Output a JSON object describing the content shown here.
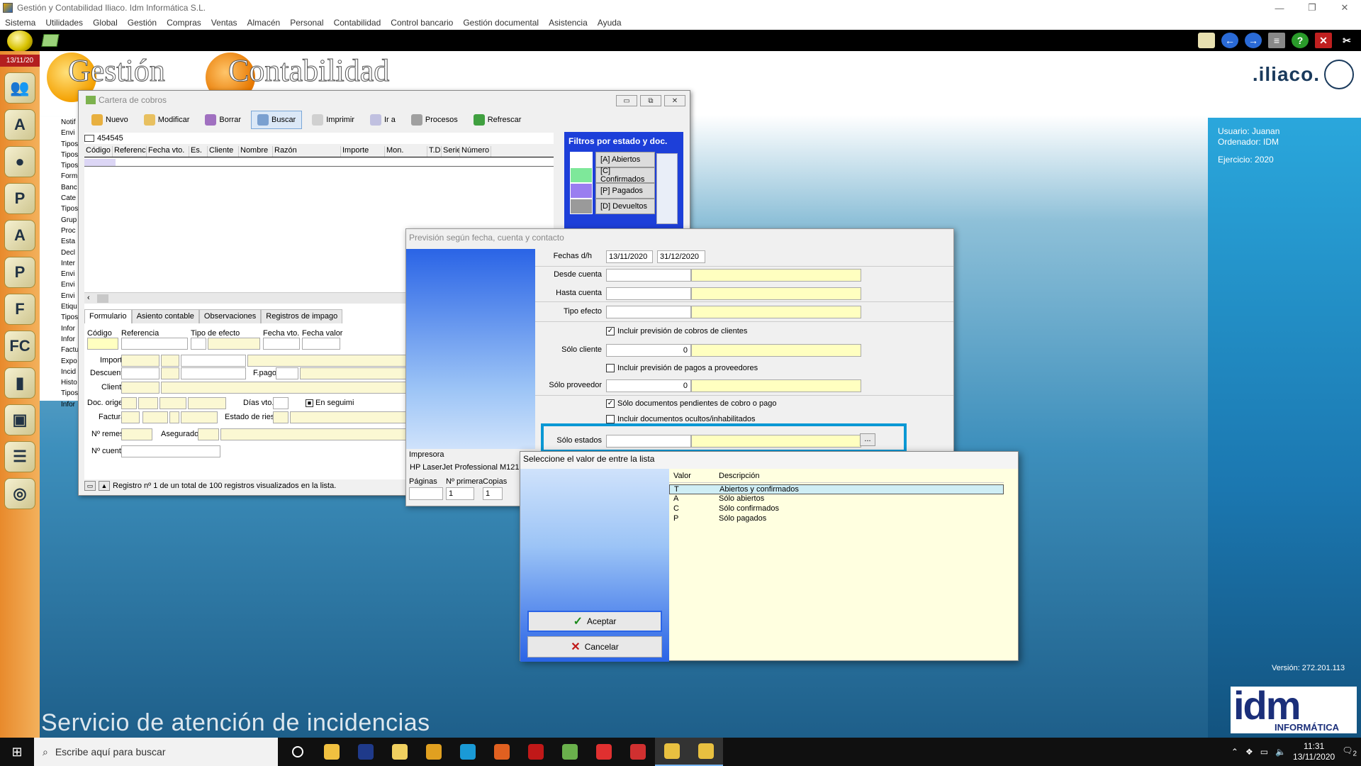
{
  "window": {
    "title": "Gestión y Contabilidad Iliaco. Idm Informática S.L.",
    "controls": [
      "—",
      "❐",
      "✕"
    ]
  },
  "menubar": [
    "Sistema",
    "Utilidades",
    "Global",
    "Gestión",
    "Compras",
    "Ventas",
    "Almacén",
    "Personal",
    "Contabilidad",
    "Control bancario",
    "Gestión documental",
    "Asistencia",
    "Ayuda"
  ],
  "sidebar": {
    "date": "13/11/20",
    "icons": [
      "users-icon",
      "font-icon",
      "person-icon",
      "person-p-icon",
      "person-a-icon",
      "p-icon",
      "f-icon",
      "fc-icon",
      "book-icon",
      "box-icon",
      "list-icon",
      "disc-icon"
    ]
  },
  "desktop": {
    "brand_g": "Gestión",
    "brand_c": "Contabilidad",
    "iliaco": ".iliaco.",
    "service": "Servicio de atención de incidencias"
  },
  "leftlist": [
    "Notif",
    "Envi",
    "Tipos",
    "Tipos",
    "Tipos",
    "Form",
    "Banc",
    "Cate",
    "Tipos",
    "Grup",
    "Proc",
    "Esta",
    "Decl",
    "Inter",
    "Envi",
    "Envi",
    "Envi",
    "Etiqu",
    "Tipos",
    "Infor",
    "Infor",
    "Factu",
    "Expo",
    "Incid",
    "Histo",
    "Tipos",
    "Infor"
  ],
  "infopanel": {
    "user": "Usuario: Juanan",
    "computer": "Ordenador: IDM",
    "year": "Ejercicio: 2020",
    "version": "Versión: 272.201.113"
  },
  "idm": {
    "big": "idm",
    "small": "INFORMÁTICA"
  },
  "cartera": {
    "title": "Cartera de cobros",
    "controls": [
      "▭",
      "⧉",
      "✕"
    ],
    "toolbar": [
      {
        "label": "Nuevo",
        "color": "#e8b040"
      },
      {
        "label": "Modificar",
        "color": "#e8c060"
      },
      {
        "label": "Borrar",
        "color": "#a070c0"
      },
      {
        "label": "Buscar",
        "color": "#7aa0d0"
      },
      {
        "label": "Imprimir",
        "color": "#d0d0d0"
      },
      {
        "label": "Ir a",
        "color": "#c0c0e0"
      },
      {
        "label": "Procesos",
        "color": "#a0a0a0"
      },
      {
        "label": "Refrescar",
        "color": "#40a040"
      }
    ],
    "search_value": "454545",
    "columns": [
      "Código",
      "Referencia",
      "Fecha vto.",
      "Es.",
      "Cliente",
      "Nombre",
      "Razón",
      "Importe",
      "Mon.",
      "T.D.",
      "Serie",
      "Número"
    ],
    "filters": {
      "title": "Filtros por estado y doc.",
      "items": [
        {
          "label": "[A] Abiertos",
          "color": "#ffffff"
        },
        {
          "label": "[C] Confirmados",
          "color": "#7ee89a"
        },
        {
          "label": "[P] Pagados",
          "color": "#9a7ef0"
        },
        {
          "label": "[D] Devueltos",
          "color": "#9a9a9a"
        }
      ]
    },
    "tabs": [
      "Formulario",
      "Asiento contable",
      "Observaciones",
      "Registros de impago"
    ],
    "form": {
      "codigo": "Código",
      "referencia": "Referencia",
      "tipo_efecto": "Tipo de efecto",
      "fecha_vto": "Fecha vto.",
      "fecha_valor": "Fecha valor",
      "importe": "Importe",
      "descuento": "Descuento",
      "fpago": "F.pago",
      "cliente": "Cliente",
      "doc_origen": "Doc. origen",
      "dias_vto": "Días vto.",
      "en_seguim": "En seguimi",
      "factura": "Factura",
      "estado_riesgo": "Estado de riesgo",
      "n_remesa": "Nº remesa",
      "aseguradora": "Aseguradora",
      "n_cuenta": "Nº cuenta"
    },
    "status": "Registro nº 1 de un total de 100 registros visualizados en la lista."
  },
  "prevision": {
    "title": "Previsión según fecha, cuenta y contacto",
    "fechas_label": "Fechas d/h",
    "fecha_desde": "13/11/2020",
    "fecha_hasta": "31/12/2020",
    "desde_cuenta": "Desde cuenta",
    "hasta_cuenta": "Hasta cuenta",
    "tipo_efecto": "Tipo efecto",
    "incluir_cobros": "Incluir previsión de cobros de clientes",
    "solo_cliente": "Sólo cliente",
    "solo_cliente_val": "0",
    "incluir_pagos": "Incluir previsión de pagos a proveedores",
    "solo_proveedor": "Sólo proveedor",
    "solo_proveedor_val": "0",
    "solo_pendientes": "Sólo documentos pendientes de cobro o pago",
    "incluir_ocultos": "Incluir documentos ocultos/inhabilitados",
    "solo_estados": "Sólo estados",
    "dots": "...",
    "impresora_label": "Impresora",
    "impresora": "HP LaserJet Professional M1217",
    "paginas": "Páginas",
    "n_primera": "Nº primera",
    "copias": "Copias",
    "n_primera_val": "1",
    "copias_val": "1"
  },
  "selector": {
    "title": "Seleccione el valor de entre la lista",
    "col_valor": "Valor",
    "col_desc": "Descripción",
    "rows": [
      {
        "valor": "T",
        "desc": "Abiertos y confirmados"
      },
      {
        "valor": "A",
        "desc": "Sólo abiertos"
      },
      {
        "valor": "C",
        "desc": "Sólo confirmados"
      },
      {
        "valor": "P",
        "desc": "Sólo pagados"
      }
    ],
    "ok": "Aceptar",
    "cancel": "Cancelar"
  },
  "taskbar": {
    "search_placeholder": "Escribe aquí para buscar",
    "time": "11:31",
    "date": "13/11/2020",
    "notif_count": "2",
    "apps": [
      {
        "name": "task-view",
        "color": "#ffffff"
      },
      {
        "name": "explorer",
        "color": "#f0c040"
      },
      {
        "name": "photoshop",
        "color": "#1f3a8a"
      },
      {
        "name": "folder",
        "color": "#f0d060"
      },
      {
        "name": "chrome",
        "color": "#e0a020"
      },
      {
        "name": "edge",
        "color": "#1a9ad6"
      },
      {
        "name": "firefox",
        "color": "#e06020"
      },
      {
        "name": "filezilla",
        "color": "#c01818"
      },
      {
        "name": "notepad",
        "color": "#6ab04c"
      },
      {
        "name": "anydesk",
        "color": "#e03030"
      },
      {
        "name": "rx",
        "color": "#d03030"
      },
      {
        "name": "iliaco-a",
        "color": "#e8c040"
      },
      {
        "name": "iliaco-b",
        "color": "#e8c040"
      }
    ]
  }
}
